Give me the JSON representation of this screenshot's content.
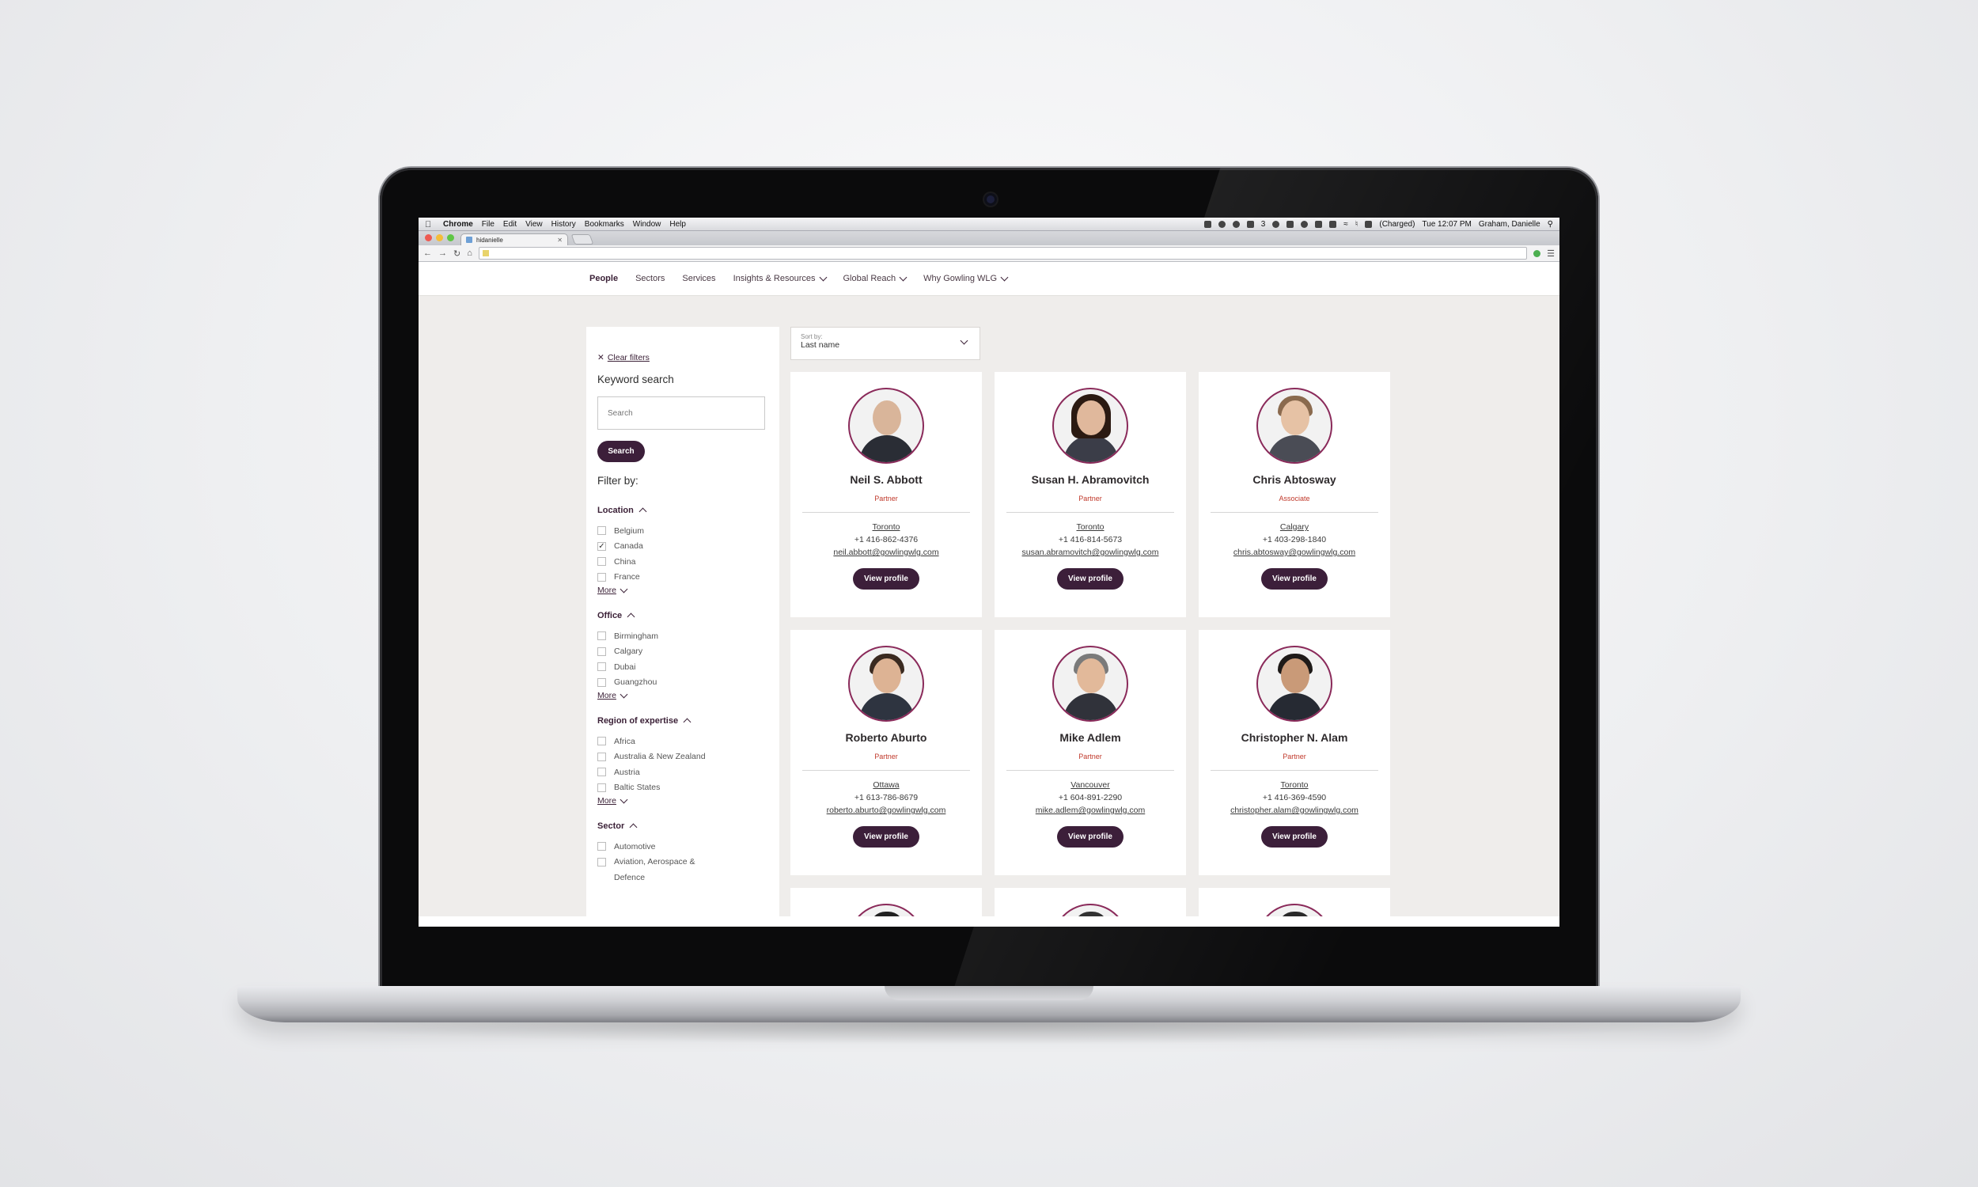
{
  "menubar": {
    "app": "Chrome",
    "items": [
      "File",
      "Edit",
      "View",
      "History",
      "Bookmarks",
      "Window",
      "Help"
    ],
    "badge": "3",
    "battery": "(Charged)",
    "clock": "Tue 12:07 PM",
    "user": "Graham, Danielle"
  },
  "browser": {
    "tab_title": "hidanielle"
  },
  "nav": {
    "items": [
      "People",
      "Sectors",
      "Services",
      "Insights & Resources",
      "Global Reach",
      "Why Gowling WLG"
    ]
  },
  "filters": {
    "clear_label": "Clear filters",
    "keyword_heading": "Keyword search",
    "search_placeholder": "Search",
    "search_button": "Search",
    "filter_by": "Filter by:",
    "more_label": "More",
    "location": {
      "label": "Location",
      "options": [
        "Belgium",
        "Canada",
        "China",
        "France"
      ]
    },
    "office": {
      "label": "Office",
      "options": [
        "Birmingham",
        "Calgary",
        "Dubai",
        "Guangzhou"
      ]
    },
    "region": {
      "label": "Region of expertise",
      "options": [
        "Africa",
        "Australia & New Zealand",
        "Austria",
        "Baltic States"
      ]
    },
    "sector": {
      "label": "Sector",
      "options": [
        "Automotive",
        "Aviation, Aerospace &",
        "Defence"
      ]
    }
  },
  "sort": {
    "label": "Sort by:",
    "value": "Last name"
  },
  "people": [
    {
      "name": "Neil S. Abbott",
      "title": "Partner",
      "city": "Toronto",
      "phone": "+1 416-862-4376",
      "email": "neil.abbott@gowlingwlg.com"
    },
    {
      "name": "Susan H. Abramovitch",
      "title": "Partner",
      "city": "Toronto",
      "phone": "+1 416-814-5673",
      "email": "susan.abramovitch@gowlingwlg.com"
    },
    {
      "name": "Chris Abtosway",
      "title": "Associate",
      "city": "Calgary",
      "phone": "+1 403-298-1840",
      "email": "chris.abtosway@gowlingwlg.com"
    },
    {
      "name": "Roberto Aburto",
      "title": "Partner",
      "city": "Ottawa",
      "phone": "+1 613-786-8679",
      "email": "roberto.aburto@gowlingwlg.com"
    },
    {
      "name": "Mike Adlem",
      "title": "Partner",
      "city": "Vancouver",
      "phone": "+1 604-891-2290",
      "email": "mike.adlem@gowlingwlg.com"
    },
    {
      "name": "Christopher N. Alam",
      "title": "Partner",
      "city": "Toronto",
      "phone": "+1 416-369-4590",
      "email": "christopher.alam@gowlingwlg.com"
    }
  ],
  "view_profile_label": "View profile",
  "colors": {
    "accent": "#3c1f3a",
    "ring": "#8a2a5a",
    "role": "#c0392b",
    "page_bg": "#efedeb"
  }
}
